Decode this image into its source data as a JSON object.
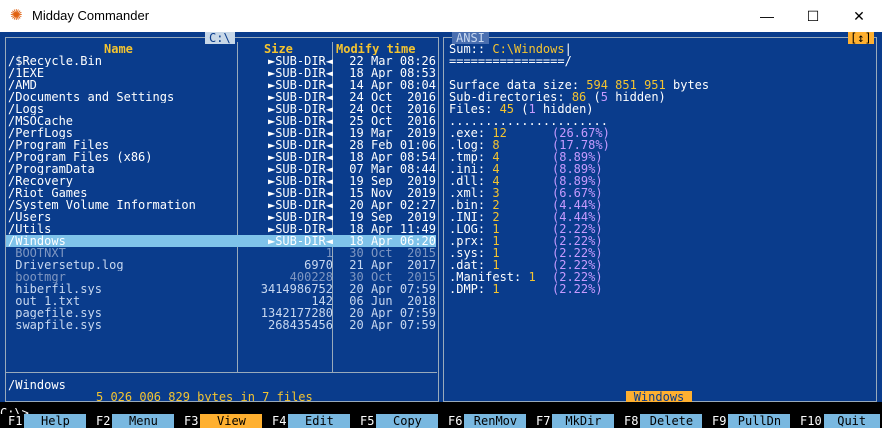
{
  "window": {
    "title": "Midday Commander",
    "minimize": "—",
    "maximize": "☐",
    "close": "✕"
  },
  "left_panel": {
    "path": "C:\\",
    "headers": {
      "name": "Name",
      "size": "Size",
      "time": "Modify time"
    },
    "rows": [
      {
        "name": "/$Recycle.Bin",
        "size": "►SUB-DIR◄",
        "time": "22 Mar 08:26",
        "kind": "dir"
      },
      {
        "name": "/1EXE",
        "size": "►SUB-DIR◄",
        "time": "18 Apr 08:53",
        "kind": "dir"
      },
      {
        "name": "/AMD",
        "size": "►SUB-DIR◄",
        "time": "14 Apr 08:04",
        "kind": "dir"
      },
      {
        "name": "/Documents and Settings",
        "size": "►SUB-DIR◄",
        "time": "24 Oct  2016",
        "kind": "dir"
      },
      {
        "name": "/Logs",
        "size": "►SUB-DIR◄",
        "time": "24 Oct  2016",
        "kind": "dir"
      },
      {
        "name": "/MSOCache",
        "size": "►SUB-DIR◄",
        "time": "25 Oct  2016",
        "kind": "dir"
      },
      {
        "name": "/PerfLogs",
        "size": "►SUB-DIR◄",
        "time": "19 Mar  2019",
        "kind": "dir"
      },
      {
        "name": "/Program Files",
        "size": "►SUB-DIR◄",
        "time": "28 Feb 01:06",
        "kind": "dir"
      },
      {
        "name": "/Program Files (x86)",
        "size": "►SUB-DIR◄",
        "time": "18 Apr 08:54",
        "kind": "dir"
      },
      {
        "name": "/ProgramData",
        "size": "►SUB-DIR◄",
        "time": "07 Mar 08:44",
        "kind": "dir"
      },
      {
        "name": "/Recovery",
        "size": "►SUB-DIR◄",
        "time": "19 Sep  2019",
        "kind": "dir"
      },
      {
        "name": "/Riot Games",
        "size": "►SUB-DIR◄",
        "time": "15 Nov  2019",
        "kind": "dir"
      },
      {
        "name": "/System Volume Information",
        "size": "►SUB-DIR◄",
        "time": "20 Apr 02:27",
        "kind": "dir"
      },
      {
        "name": "/Users",
        "size": "►SUB-DIR◄",
        "time": "19 Sep  2019",
        "kind": "dir"
      },
      {
        "name": "/Utils",
        "size": "►SUB-DIR◄",
        "time": "18 Apr 11:49",
        "kind": "dir"
      },
      {
        "name": "/Windows",
        "size": "►SUB-DIR◄",
        "time": "18 Apr 06:20",
        "kind": "selected"
      },
      {
        "name": " BOOTNXT",
        "size": "1",
        "time": "30 Oct  2015",
        "kind": "hidden"
      },
      {
        "name": " Driversetup.log",
        "size": "6970",
        "time": "21 Apr  2017",
        "kind": "file"
      },
      {
        "name": " bootmgr",
        "size": "400228",
        "time": "30 Oct  2015",
        "kind": "hidden"
      },
      {
        "name": " hiberfil.sys",
        "size": "3414986752",
        "time": "20 Apr 07:59",
        "kind": "file"
      },
      {
        "name": " out_1.txt",
        "size": "142",
        "time": "06 Jun  2018",
        "kind": "file"
      },
      {
        "name": " pagefile.sys",
        "size": "1342177280",
        "time": "20 Apr 07:59",
        "kind": "file"
      },
      {
        "name": " swapfile.sys",
        "size": "268435456",
        "time": "20 Apr 07:59",
        "kind": "file"
      }
    ],
    "current": "/Windows",
    "summary": "5 026 006 829 bytes in 7 files"
  },
  "right_panel": {
    "tag": "ANSI",
    "corner": "[↕]",
    "sum_label": "Sum:: ",
    "sum_path": "C:\\Windows",
    "sum_cursor": "|",
    "rule": "================/",
    "surface_label": "Surface data size: ",
    "surface_value": "594 851 951",
    "surface_unit": " bytes",
    "subdir_label": "Sub-directories: ",
    "subdir_count": "86",
    "subdir_open": " (",
    "subdir_hidden_n": "5",
    "subdir_hidden_word": " hidden)",
    "files_label": "Files: ",
    "files_count": "45",
    "files_open": " (",
    "files_hidden_n": "1",
    "files_hidden_word": " hidden)",
    "dots": "......................",
    "exts": [
      {
        "ext": ".exe: ",
        "n": "12",
        "pct": "(26.67%)"
      },
      {
        "ext": ".log: ",
        "n": "8",
        "pct": "(17.78%)"
      },
      {
        "ext": ".tmp: ",
        "n": "4",
        "pct": "(8.89%)"
      },
      {
        "ext": ".ini: ",
        "n": "4",
        "pct": "(8.89%)"
      },
      {
        "ext": ".dll: ",
        "n": "4",
        "pct": "(8.89%)"
      },
      {
        "ext": ".xml: ",
        "n": "3",
        "pct": "(6.67%)"
      },
      {
        "ext": ".bin: ",
        "n": "2",
        "pct": "(4.44%)"
      },
      {
        "ext": ".INI: ",
        "n": "2",
        "pct": "(4.44%)"
      },
      {
        "ext": ".LOG: ",
        "n": "1",
        "pct": "(2.22%)"
      },
      {
        "ext": ".prx: ",
        "n": "1",
        "pct": "(2.22%)"
      },
      {
        "ext": ".sys: ",
        "n": "1",
        "pct": "(2.22%)"
      },
      {
        "ext": ".dat: ",
        "n": "1",
        "pct": "(2.22%)"
      },
      {
        "ext": ".Manifest: ",
        "n": "1",
        "pct": "(2.22%)"
      },
      {
        "ext": ".DMP: ",
        "n": "1",
        "pct": "(2.22%)"
      }
    ],
    "footer": "Windows"
  },
  "command_line": "C:\\>",
  "fkeys": [
    {
      "num": "F1",
      "label": "Help"
    },
    {
      "num": "F2",
      "label": "Menu"
    },
    {
      "num": "F3",
      "label": "View"
    },
    {
      "num": "F4",
      "label": "Edit"
    },
    {
      "num": "F5",
      "label": "Copy"
    },
    {
      "num": "F6",
      "label": "RenMov"
    },
    {
      "num": "F7",
      "label": "MkDir"
    },
    {
      "num": "F8",
      "label": "Delete"
    },
    {
      "num": "F9",
      "label": "PullDn"
    },
    {
      "num": "F10",
      "label": "Quit"
    }
  ],
  "colors": {
    "bg": "#0a3c8c",
    "dir": "#ffffff",
    "file": "#c8d8f0",
    "hidden": "#7f97c2",
    "sizecol": "#ffffff",
    "selected_bg": "#7fc3ea",
    "selected_fg": "#ffffff",
    "yellow": "#f4c430",
    "violet": "#c79bff",
    "fkey_bg": "#79b8e0",
    "fkey_highlight": "#ffb030"
  }
}
